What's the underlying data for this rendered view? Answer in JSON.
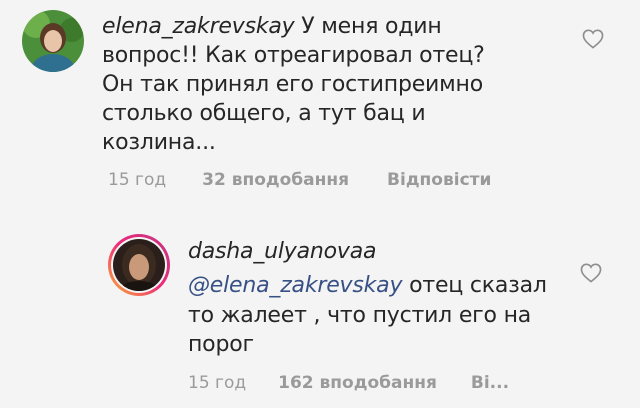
{
  "comments": [
    {
      "username": "elena_zakrevskay",
      "text_line1": " У меня один",
      "lines": [
        "вопрос!! Как отреагировал отец?",
        "Он так принял его гостипреимно",
        "столько общего, а тут бац и",
        "козлина..."
      ],
      "time": "15 год",
      "likes": "32 вподобання",
      "reply": "Відповісти"
    },
    {
      "username": "dasha_ulyanovaa",
      "mention": "@elena_zakrevskay",
      "text_line1": " отец сказал",
      "lines": [
        "то жалеет , что пустил его на",
        "порог"
      ],
      "time": "15 год",
      "likes": "162 вподобання",
      "reply": "Ві..."
    }
  ],
  "icons": {
    "like": "heart-outline-icon"
  }
}
